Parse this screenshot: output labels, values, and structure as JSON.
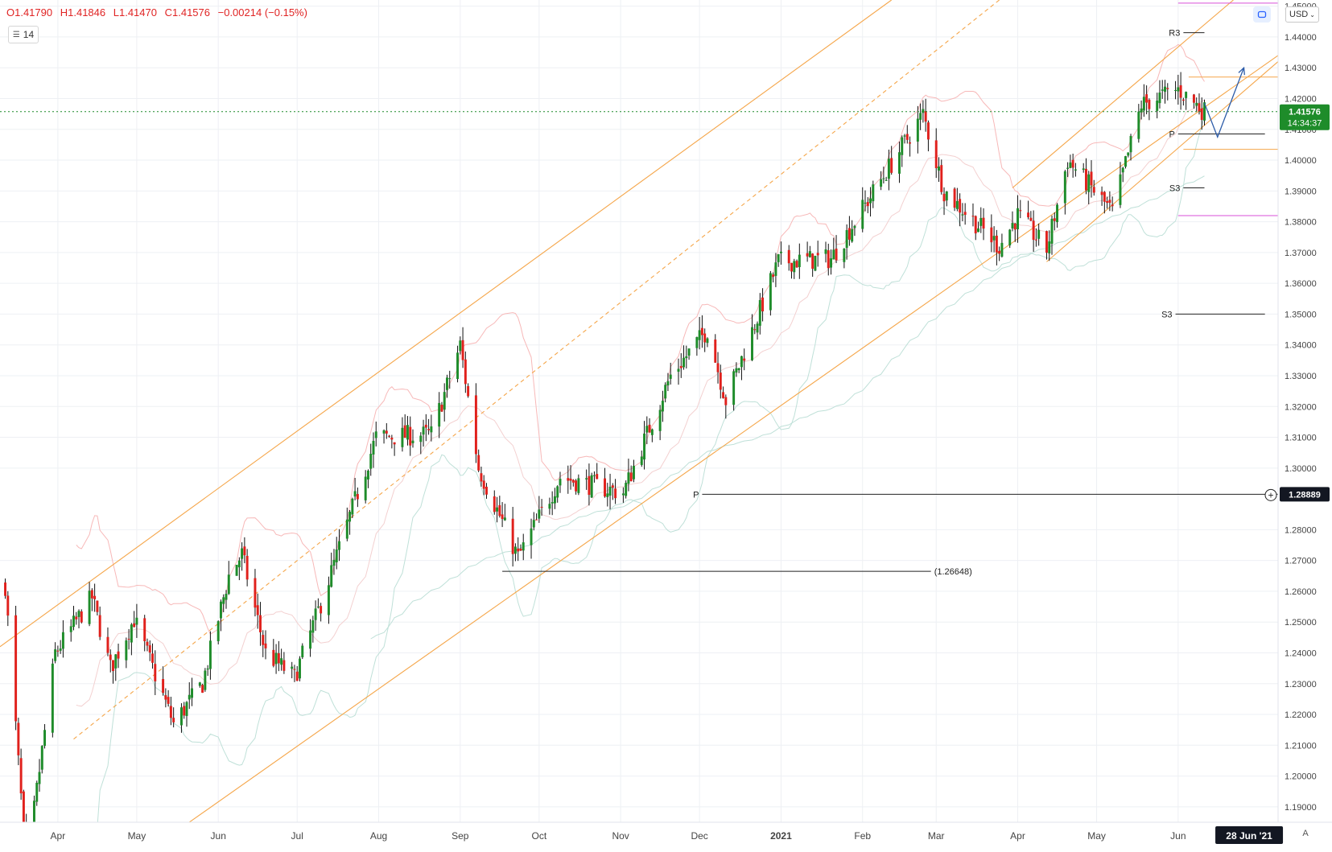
{
  "legend": {
    "open": "O1.41790",
    "high": "H1.41846",
    "low": "L1.41470",
    "close": "C1.41576",
    "change": "−0.00214 (−0.15%)",
    "period": "14"
  },
  "price_axis": {
    "currency_label": "USD",
    "last_price_label": "1.41576",
    "countdown_label": "14:34:37",
    "crosshair_label": "1.28889"
  },
  "colors": {
    "up_candle": "#1e8c2a",
    "down_candle": "#e0201c",
    "channel": "#f5a64a",
    "pivot_line": "#222222",
    "magenta_level": "#d94fd9",
    "current_price": "#1e8c2a",
    "projection_arrow": "#2a5aa8",
    "bollinger": "#f7b8b8",
    "moving_average": "#bfe0d8"
  },
  "chart_data": {
    "type": "candlestick",
    "symbol_pair_quote": "USD",
    "y_range": [
      1.185,
      1.452
    ],
    "y_ticks": [
      {
        "value": 1.19,
        "label": "1.19000"
      },
      {
        "value": 1.2,
        "label": "1.20000"
      },
      {
        "value": 1.21,
        "label": "1.21000"
      },
      {
        "value": 1.22,
        "label": "1.22000"
      },
      {
        "value": 1.23,
        "label": "1.23000"
      },
      {
        "value": 1.24,
        "label": "1.24000"
      },
      {
        "value": 1.25,
        "label": "1.25000"
      },
      {
        "value": 1.26,
        "label": "1.26000"
      },
      {
        "value": 1.27,
        "label": "1.27000"
      },
      {
        "value": 1.28,
        "label": "1.28000"
      },
      {
        "value": 1.3,
        "label": "1.30000"
      },
      {
        "value": 1.31,
        "label": "1.31000"
      },
      {
        "value": 1.32,
        "label": "1.32000"
      },
      {
        "value": 1.33,
        "label": "1.33000"
      },
      {
        "value": 1.34,
        "label": "1.34000"
      },
      {
        "value": 1.35,
        "label": "1.35000"
      },
      {
        "value": 1.36,
        "label": "1.36000"
      },
      {
        "value": 1.37,
        "label": "1.37000"
      },
      {
        "value": 1.38,
        "label": "1.38000"
      },
      {
        "value": 1.39,
        "label": "1.39000"
      },
      {
        "value": 1.4,
        "label": "1.40000"
      },
      {
        "value": 1.41,
        "label": "1.41000"
      },
      {
        "value": 1.42,
        "label": "1.42000"
      },
      {
        "value": 1.43,
        "label": "1.43000"
      },
      {
        "value": 1.44,
        "label": "1.44000"
      },
      {
        "value": 1.45,
        "label": "1.45000"
      }
    ],
    "x_ticks": [
      {
        "date": "2020-04-01",
        "label": "Apr"
      },
      {
        "date": "2020-05-01",
        "label": "May"
      },
      {
        "date": "2020-06-01",
        "label": "Jun"
      },
      {
        "date": "2020-07-01",
        "label": "Jul"
      },
      {
        "date": "2020-08-01",
        "label": "Aug"
      },
      {
        "date": "2020-09-01",
        "label": "Sep"
      },
      {
        "date": "2020-10-01",
        "label": "Oct"
      },
      {
        "date": "2020-11-01",
        "label": "Nov"
      },
      {
        "date": "2020-12-01",
        "label": "Dec"
      },
      {
        "date": "2021-01-01",
        "label": "2021"
      },
      {
        "date": "2021-02-01",
        "label": "Feb"
      },
      {
        "date": "2021-03-01",
        "label": "Mar"
      },
      {
        "date": "2021-04-01",
        "label": "Apr"
      },
      {
        "date": "2021-05-01",
        "label": "May"
      },
      {
        "date": "2021-06-01",
        "label": "Jun"
      }
    ],
    "x_highlight": {
      "date": "2021-06-28",
      "label": "28 Jun '21"
    },
    "x_range": [
      "2020-03-10",
      "2021-07-09"
    ],
    "waypoints": [
      {
        "date": "2020-03-12",
        "price": 1.262
      },
      {
        "date": "2020-03-20",
        "price": 1.17
      },
      {
        "date": "2020-03-31",
        "price": 1.24
      },
      {
        "date": "2020-04-14",
        "price": 1.258
      },
      {
        "date": "2020-04-21",
        "price": 1.235
      },
      {
        "date": "2020-04-30",
        "price": 1.251
      },
      {
        "date": "2020-05-15",
        "price": 1.217
      },
      {
        "date": "2020-05-26",
        "price": 1.23
      },
      {
        "date": "2020-06-05",
        "price": 1.265
      },
      {
        "date": "2020-06-10",
        "price": 1.272
      },
      {
        "date": "2020-06-19",
        "price": 1.24
      },
      {
        "date": "2020-06-30",
        "price": 1.232
      },
      {
        "date": "2020-07-10",
        "price": 1.256
      },
      {
        "date": "2020-07-31",
        "price": 1.31
      },
      {
        "date": "2020-08-21",
        "price": 1.311
      },
      {
        "date": "2020-09-01",
        "price": 1.34
      },
      {
        "date": "2020-09-08",
        "price": 1.3
      },
      {
        "date": "2020-09-23",
        "price": 1.271
      },
      {
        "date": "2020-10-09",
        "price": 1.297
      },
      {
        "date": "2020-11-02",
        "price": 1.292
      },
      {
        "date": "2020-11-20",
        "price": 1.33
      },
      {
        "date": "2020-12-04",
        "price": 1.345
      },
      {
        "date": "2020-12-11",
        "price": 1.322
      },
      {
        "date": "2020-12-31",
        "price": 1.367
      },
      {
        "date": "2021-01-20",
        "price": 1.368
      },
      {
        "date": "2021-02-24",
        "price": 1.415
      },
      {
        "date": "2021-03-04",
        "price": 1.39
      },
      {
        "date": "2021-03-25",
        "price": 1.372
      },
      {
        "date": "2021-04-01",
        "price": 1.382
      },
      {
        "date": "2021-04-12",
        "price": 1.371
      },
      {
        "date": "2021-04-20",
        "price": 1.4
      },
      {
        "date": "2021-05-07",
        "price": 1.383
      },
      {
        "date": "2021-05-18",
        "price": 1.418
      },
      {
        "date": "2021-06-01",
        "price": 1.423
      },
      {
        "date": "2021-06-11",
        "price": 1.4158
      }
    ],
    "annotations": {
      "channels": [
        {
          "name": "outer-channel-upper",
          "from": {
            "date": "2020-03-10",
            "price": 1.242
          },
          "to": {
            "date": "2021-02-12",
            "price": 1.452
          }
        },
        {
          "name": "outer-channel-lower",
          "from": {
            "date": "2020-05-16",
            "price": 1.182
          },
          "to": {
            "date": "2021-07-09",
            "price": 1.434
          }
        },
        {
          "name": "outer-channel-mid",
          "style": "dashed",
          "from": {
            "date": "2020-04-07",
            "price": 1.212
          },
          "to": {
            "date": "2021-03-25",
            "price": 1.452
          }
        },
        {
          "name": "inner-channel-upper",
          "from": {
            "date": "2021-03-30",
            "price": 1.391
          },
          "to": {
            "date": "2021-06-22",
            "price": 1.452
          }
        },
        {
          "name": "inner-channel-lower",
          "from": {
            "date": "2021-04-12",
            "price": 1.367
          },
          "to": {
            "date": "2021-07-09",
            "price": 1.432
          }
        }
      ],
      "horizontal_levels": [
        {
          "name": "monthly-pivot",
          "label": "P",
          "price": 1.2915,
          "from": "2020-12-02",
          "to": "2021-07-06",
          "color": "pivot"
        },
        {
          "name": "low-marker",
          "label": "(1.26648)",
          "price": 1.26648,
          "from": "2020-09-17",
          "to": "2021-02-27",
          "color": "pivot"
        },
        {
          "name": "weekly-r3",
          "label": "R3",
          "price": 1.4414,
          "from": "2021-06-03",
          "to": "2021-06-11",
          "color": "pivot"
        },
        {
          "name": "weekly-pivot",
          "label": "P",
          "price": 1.4085,
          "from": "2021-06-01",
          "to": "2021-07-04",
          "color": "pivot"
        },
        {
          "name": "weekly-s3",
          "label": "S3",
          "price": 1.391,
          "from": "2021-06-03",
          "to": "2021-06-11",
          "color": "pivot"
        },
        {
          "name": "monthly-s3",
          "label": "S3",
          "price": 1.35,
          "from": "2021-05-31",
          "to": "2021-07-04",
          "color": "pivot"
        },
        {
          "name": "resistance-orange",
          "label": "",
          "price": 1.427,
          "from": "2021-06-05",
          "to": "2021-07-09",
          "color": "channel"
        },
        {
          "name": "support-orange",
          "label": "",
          "price": 1.4035,
          "from": "2021-06-03",
          "to": "2021-07-09",
          "color": "channel"
        },
        {
          "name": "magenta-upper",
          "label": "",
          "price": 1.451,
          "from": "2021-06-01",
          "to": "2021-07-09",
          "color": "magenta"
        },
        {
          "name": "magenta-lower",
          "label": "",
          "price": 1.382,
          "from": "2021-06-01",
          "to": "2021-07-09",
          "color": "magenta"
        }
      ],
      "projection_path": [
        {
          "date": "2021-06-11",
          "price": 1.4185
        },
        {
          "date": "2021-06-16",
          "price": 1.4075
        },
        {
          "date": "2021-06-26",
          "price": 1.43
        }
      ],
      "current_price": 1.41576
    }
  }
}
